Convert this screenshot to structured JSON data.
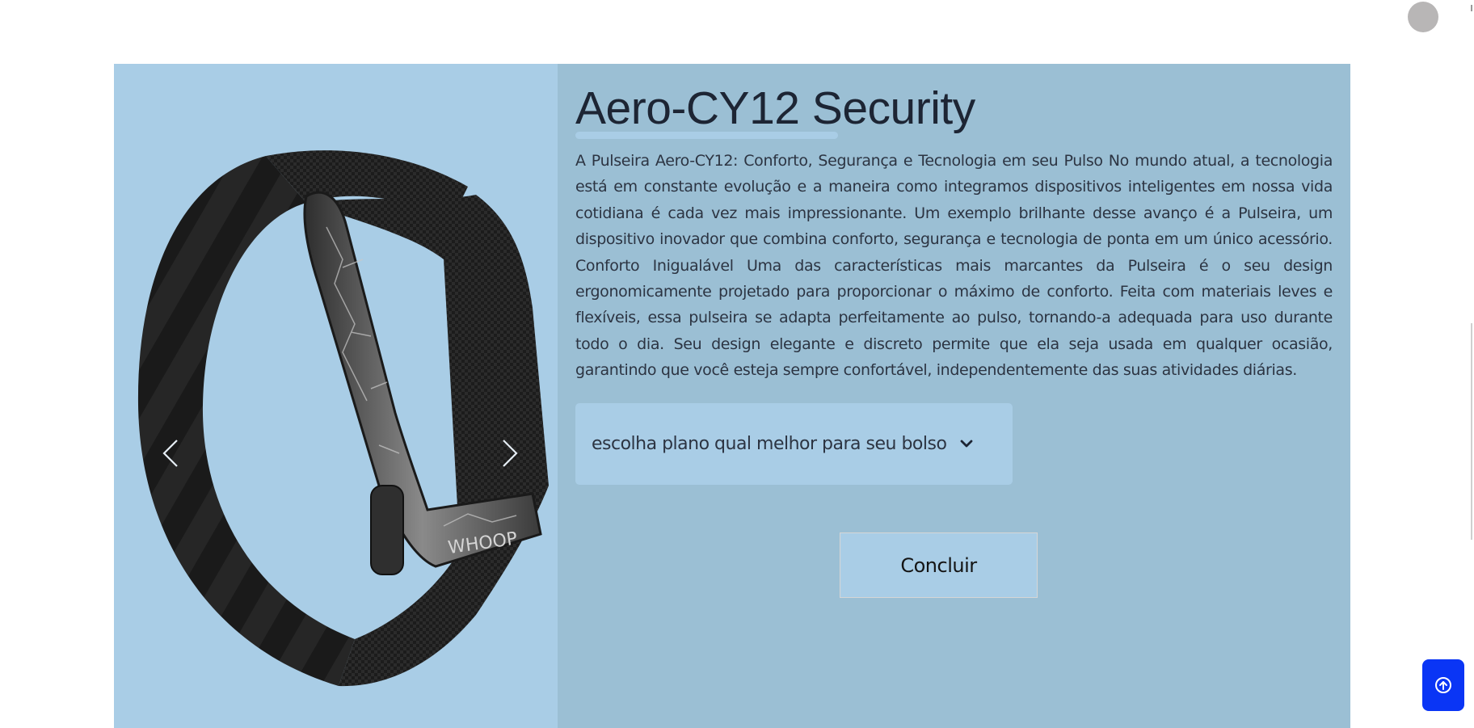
{
  "header": {
    "avatar_icon": "user-avatar-icon"
  },
  "product": {
    "title": "Aero-CY12 Security",
    "description": "A Pulseira Aero-CY12: Conforto, Segurança e Tecnologia em seu Pulso No mundo atual, a tecnologia está em constante evolução e a maneira como integramos dispositivos inteligentes em nossa vida cotidiana é cada vez mais impressionante. Um exemplo brilhante desse avanço é a Pulseira, um dispositivo inovador que combina conforto, segurança e tecnologia de ponta em um único acessório. Conforto Inigualável Uma das características mais marcantes da Pulseira é o seu design ergonomicamente projetado para proporcionar o máximo de conforto. Feita com materiais leves e flexíveis, essa pulseira se adapta perfeitamente ao pulso, tornando-a adequada para uso durante todo o dia. Seu design elegante e discreto permite que ela seja usada em qualquer ocasião, garantindo que você esteja sempre confortável, independentemente das suas atividades diárias.",
    "image_brand_mark": "WHOOP",
    "plan_select": {
      "selected_label": "escolha plano qual melhor para seu bolso",
      "chevron_icon": "chevron-down-icon"
    },
    "submit_label": "Concluir"
  },
  "carousel": {
    "prev_icon": "chevron-left-icon",
    "next_icon": "chevron-right-icon"
  },
  "colors": {
    "gallery_bg": "#a9cde6",
    "details_bg": "#9bbfd4",
    "title_color": "#1d2534",
    "back_to_top_bg": "#0a35f5"
  },
  "back_to_top_icon": "arrow-up-circle-icon"
}
